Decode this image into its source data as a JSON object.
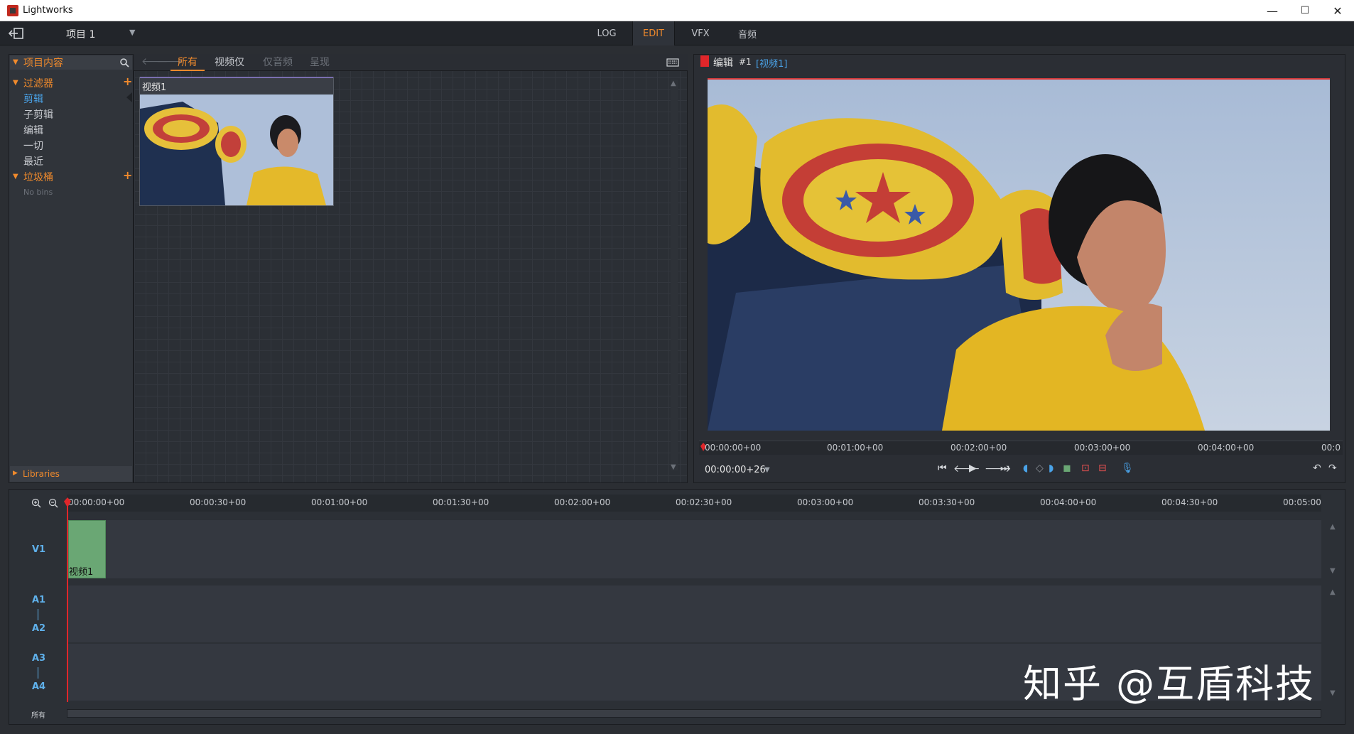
{
  "window": {
    "title": "Lightworks",
    "minimize": "—",
    "maximize": "☐",
    "close": "✕"
  },
  "topbar": {
    "project_label": "项目 1",
    "tabs": [
      {
        "label": "LOG",
        "active": false
      },
      {
        "label": "EDIT",
        "active": true
      },
      {
        "label": "VFX",
        "active": false
      },
      {
        "label": "音频",
        "active": false
      }
    ]
  },
  "left": {
    "header": "项目内容",
    "filters_label": "过滤器",
    "filter_items": [
      "剪辑",
      "子剪辑",
      "编辑",
      "一切",
      "最近"
    ],
    "selected_index": 0,
    "bins_label": "垃圾桶",
    "no_bins": "No bins",
    "libraries": "Libraries"
  },
  "browser": {
    "tabs": [
      "所有",
      "视频仅",
      "仅音频",
      "呈现"
    ],
    "active_tab": 0,
    "clip": {
      "title": "视频1"
    }
  },
  "viewer": {
    "title": "编辑",
    "number": "#1",
    "subtitle": "[视频1]",
    "timecode": "00:00:00+26",
    "ruler": [
      "00:00:00+00",
      "00:01:00+00",
      "00:02:00+00",
      "00:03:00+00",
      "00:04:00+00",
      "00:0"
    ]
  },
  "timeline": {
    "ruler": [
      "00:00:00+00",
      "00:00:30+00",
      "00:01:00+00",
      "00:01:30+00",
      "00:02:00+00",
      "00:02:30+00",
      "00:03:00+00",
      "00:03:30+00",
      "00:04:00+00",
      "00:04:30+00",
      "00:05:00"
    ],
    "tracks": {
      "v1": "V1",
      "a1": "A1",
      "a2": "A2",
      "a3": "A3",
      "a4": "A4"
    },
    "clip_label": "视频1",
    "all_label": "所有"
  },
  "watermark": "知乎 @互盾科技",
  "colors": {
    "accent": "#f08a2c",
    "blue": "#4aa3e8",
    "clip_green": "#6aa774",
    "playhead": "#e0262a"
  }
}
